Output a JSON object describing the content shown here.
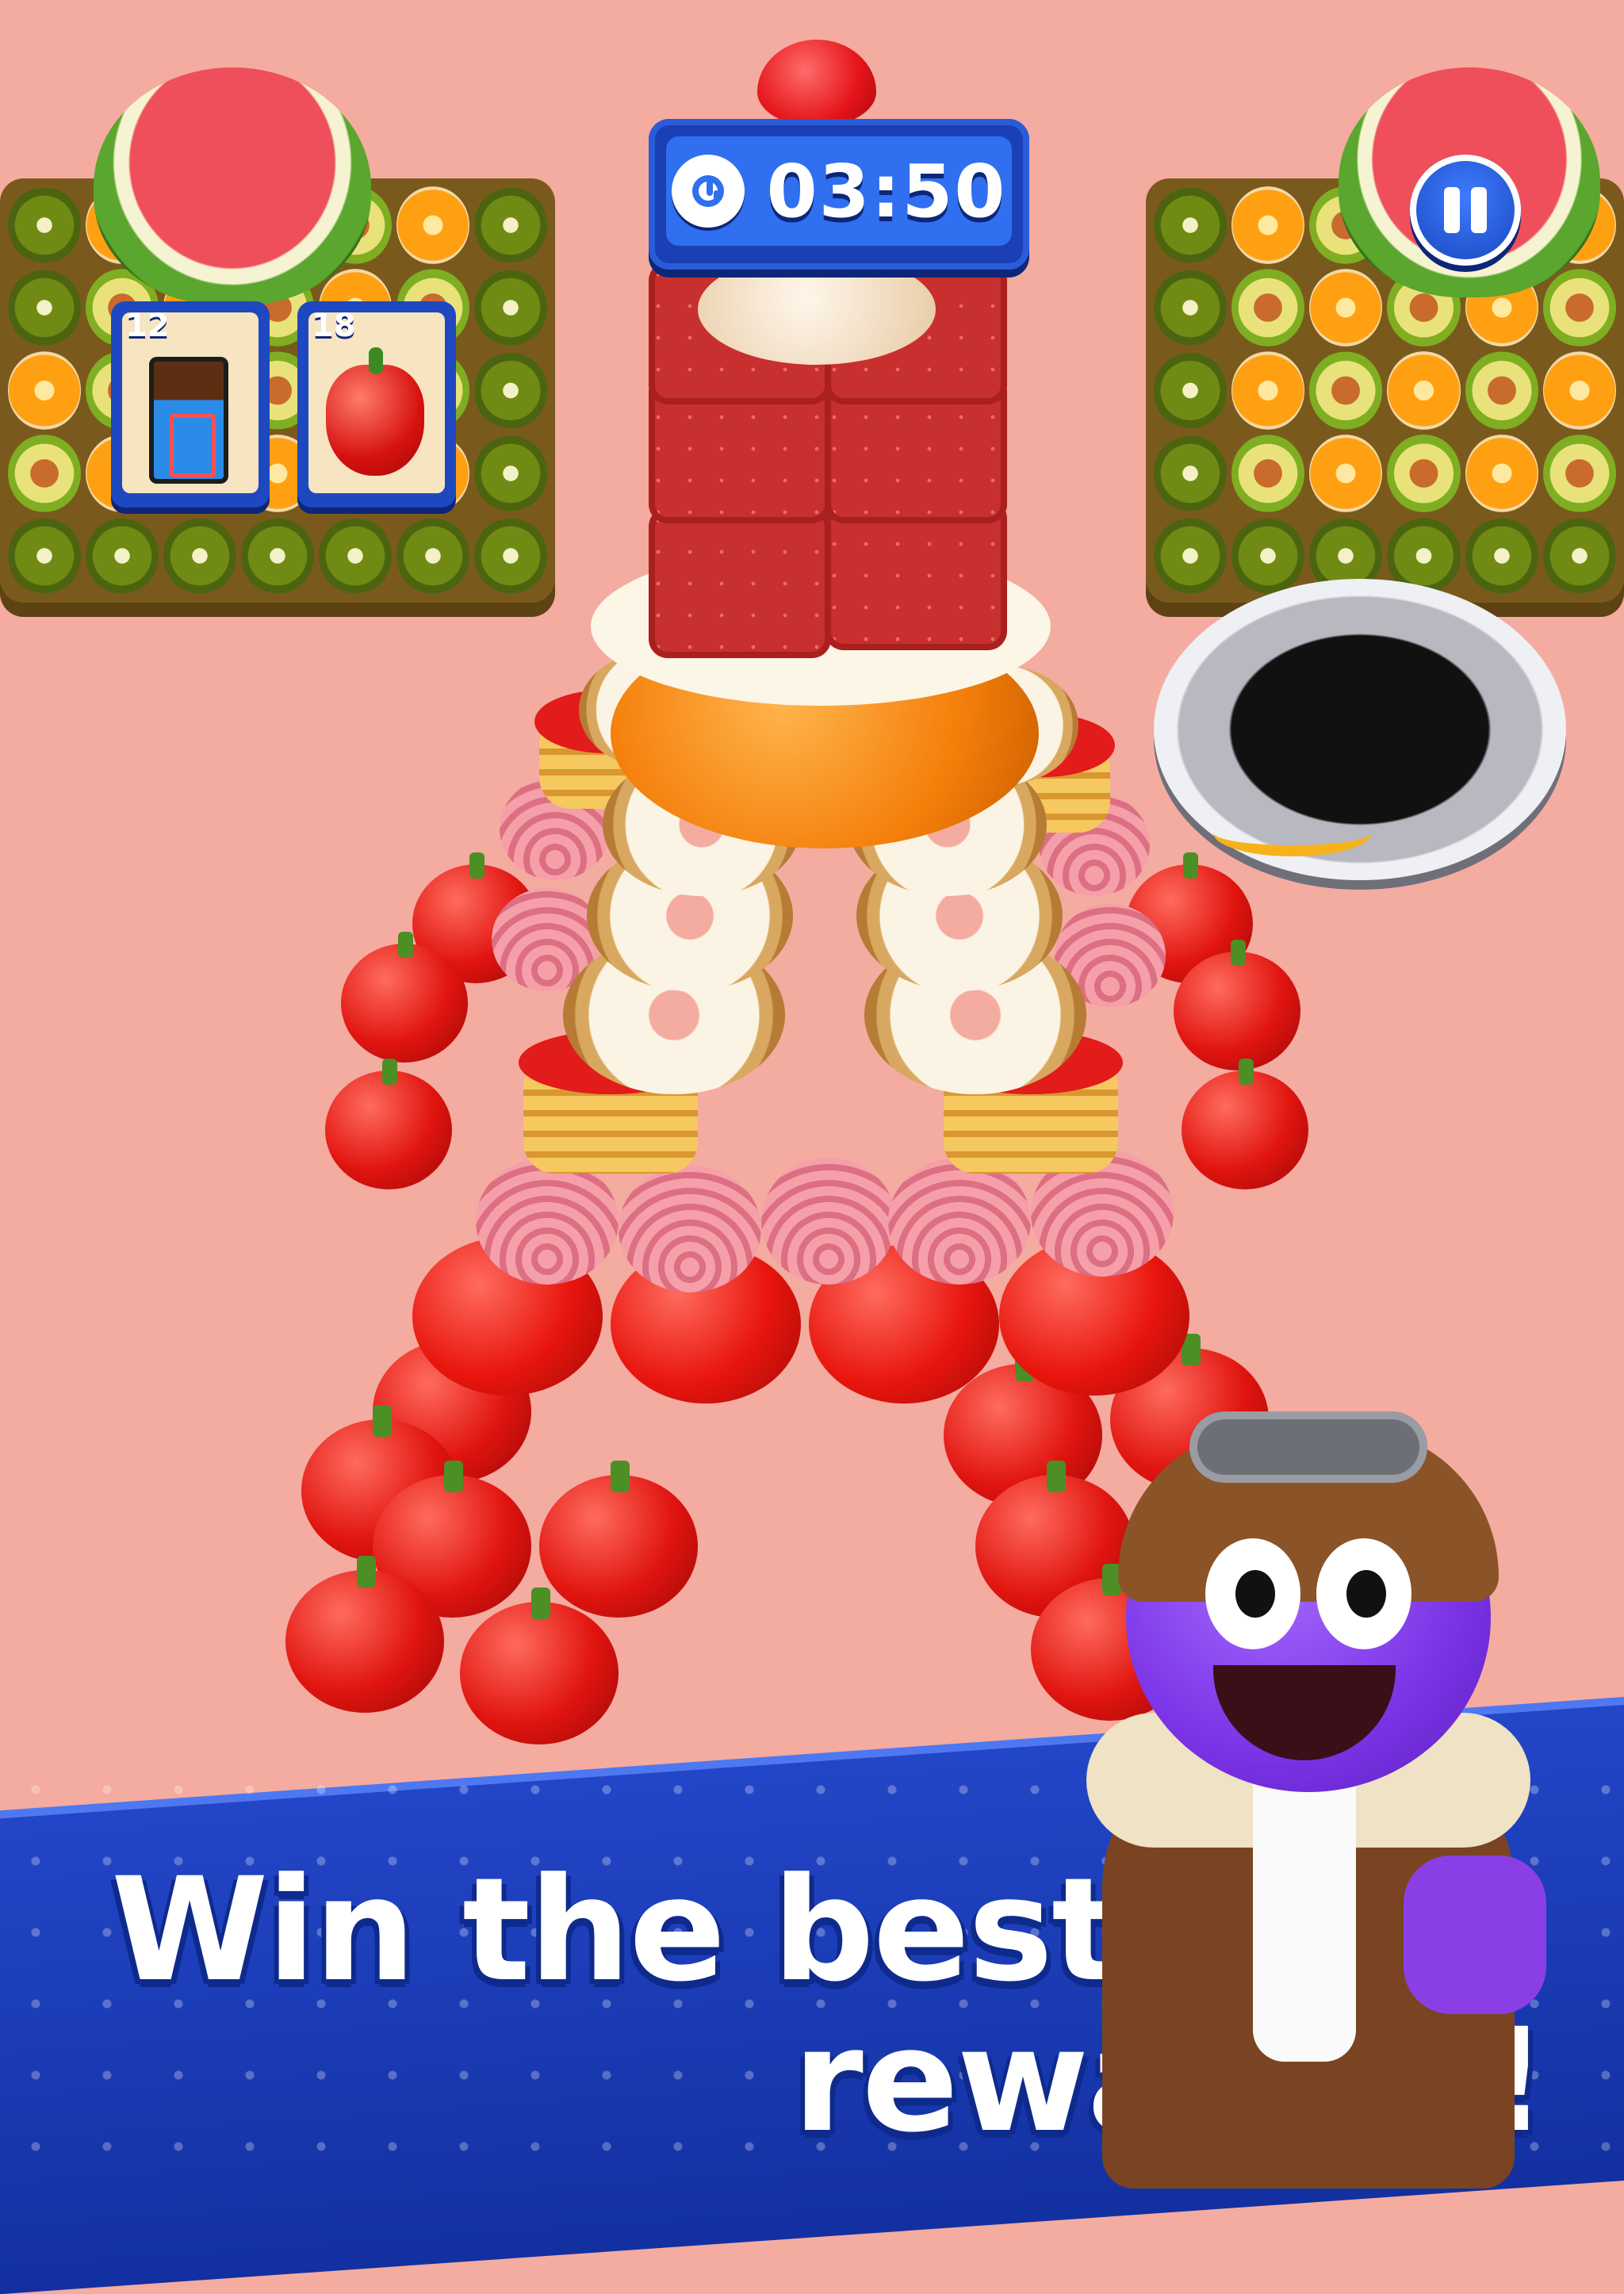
{
  "hud": {
    "timer": "03:50",
    "icons": {
      "timer": "clock-icon",
      "pause": "pause-icon"
    }
  },
  "goals": [
    {
      "count": "12",
      "item": "chocolate-bar-icon"
    },
    {
      "count": "18",
      "item": "red-pepper-icon"
    }
  ],
  "banner": {
    "line1": "Win the best",
    "line2": "rewards !"
  },
  "colors": {
    "background": "#f4aba0",
    "banner": "#2346c8",
    "hud_blue": "#2f6ff0",
    "hole_progress": "#f7b21b"
  }
}
